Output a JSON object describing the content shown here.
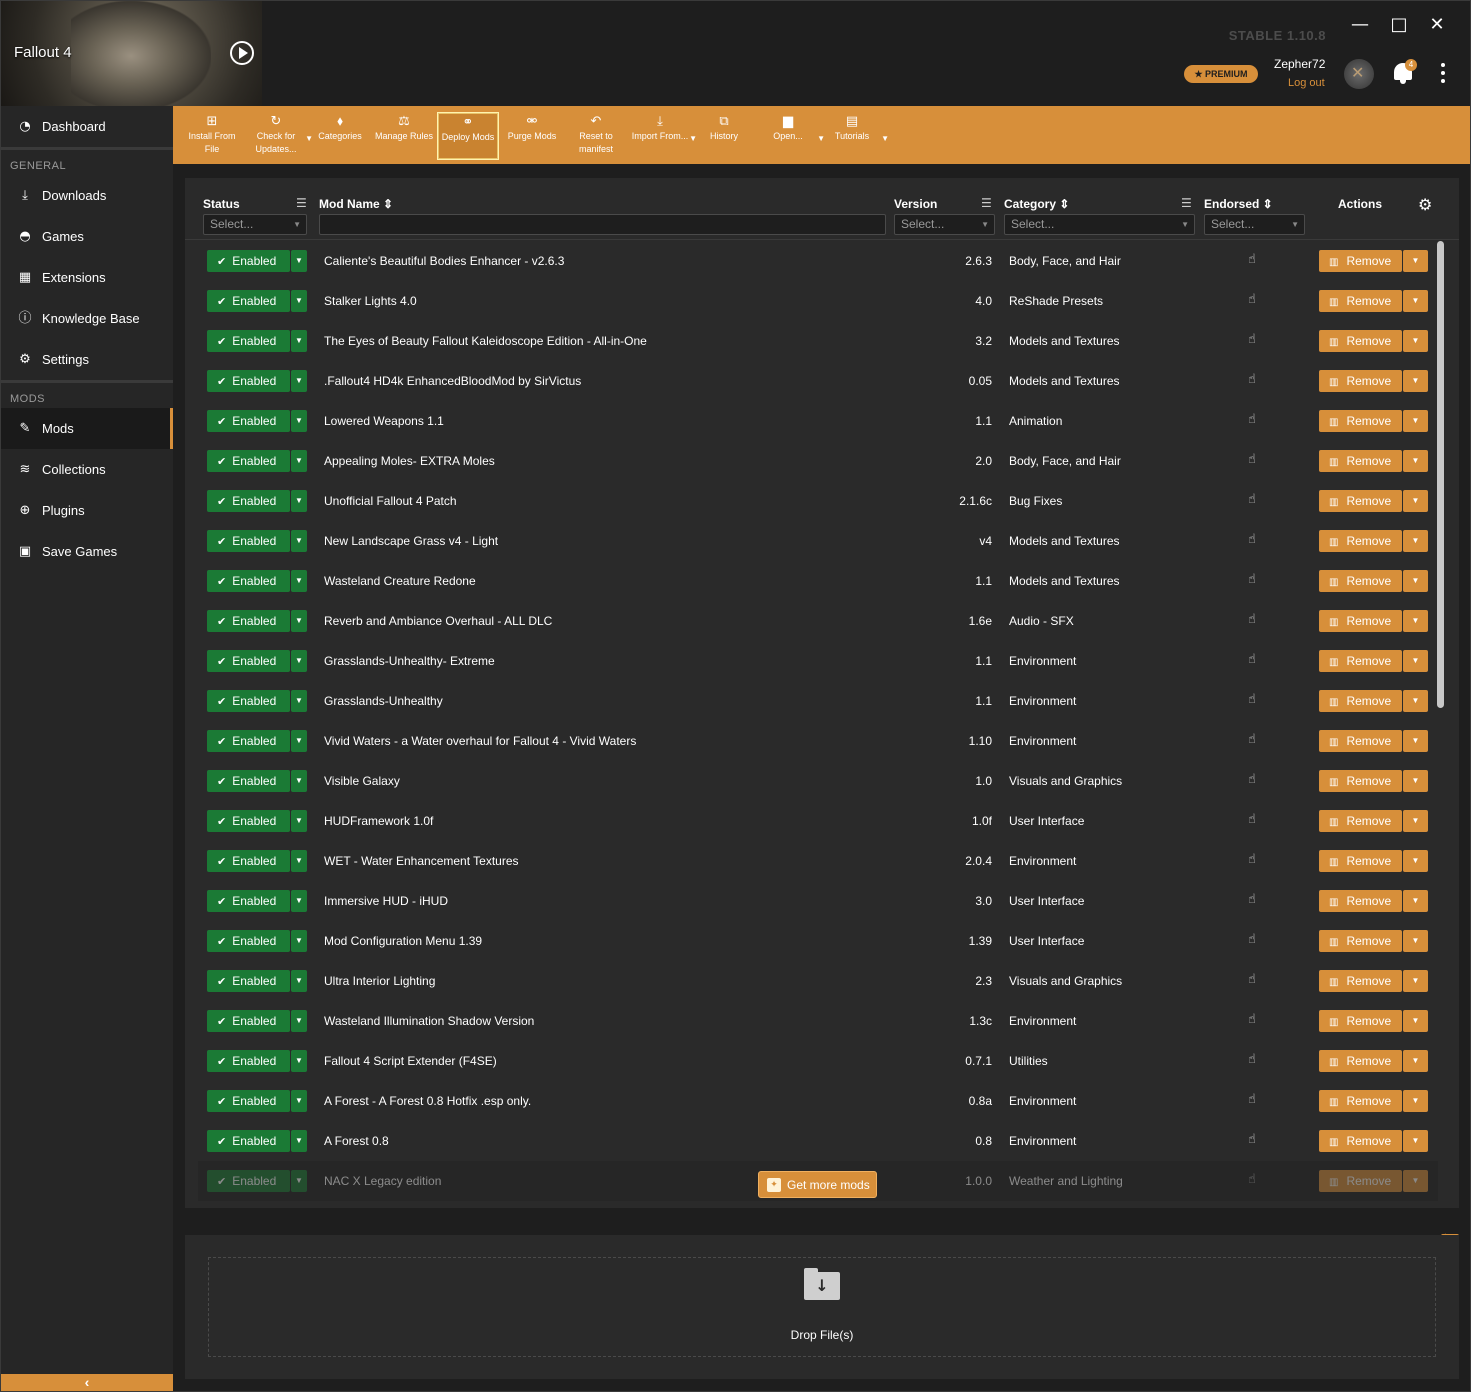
{
  "app": {
    "game_title": "Fallout 4",
    "version": "STABLE 1.10.8",
    "window_min": "—",
    "window_max": "□",
    "window_close": "✕",
    "premium_label": "★ PREMIUM",
    "username": "Zepher72",
    "logout_label": "Log out",
    "notification_count": "4",
    "colors": {
      "accent": "#d78f3a",
      "enabled": "#1b7a35",
      "background": "#1e1e1e"
    }
  },
  "sidebar": {
    "dashboard": {
      "label": "Dashboard",
      "icon": "dashboard-icon"
    },
    "general_label": "GENERAL",
    "general_items": [
      {
        "label": "Downloads",
        "icon": "download-icon"
      },
      {
        "label": "Games",
        "icon": "gamepad-icon"
      },
      {
        "label": "Extensions",
        "icon": "extensions-icon"
      },
      {
        "label": "Knowledge Base",
        "icon": "info-icon"
      },
      {
        "label": "Settings",
        "icon": "gear-icon"
      }
    ],
    "mods_label": "MODS",
    "mods_items": [
      {
        "label": "Mods",
        "icon": "wrench-icon",
        "active": true
      },
      {
        "label": "Collections",
        "icon": "layers-icon"
      },
      {
        "label": "Plugins",
        "icon": "plus-circle-icon"
      },
      {
        "label": "Save Games",
        "icon": "save-icon"
      }
    ],
    "collapse_label": "‹"
  },
  "toolbar": {
    "install": "Install From File",
    "check": "Check for Updates...",
    "categories": "Categories",
    "manage": "Manage Rules",
    "deploy": "Deploy Mods",
    "purge": "Purge Mods",
    "reset": "Reset to manifest",
    "import": "Import From...",
    "history": "History",
    "open": "Open...",
    "tutorials": "Tutorials"
  },
  "table": {
    "headers": {
      "status": "Status",
      "mod_name": "Mod Name",
      "version": "Version",
      "category": "Category",
      "endorsed": "Endorsed",
      "actions": "Actions"
    },
    "filter_placeholder": "Select...",
    "enabled_label": "Enabled",
    "remove_label": "Remove",
    "rows": [
      {
        "name": "Caliente's Beautiful Bodies Enhancer - v2.6.3",
        "version": "2.6.3",
        "category": "Body, Face, and Hair"
      },
      {
        "name": "Stalker Lights 4.0",
        "version": "4.0",
        "category": "ReShade Presets"
      },
      {
        "name": "The Eyes of Beauty Fallout Kaleidoscope Edition - All-in-One",
        "version": "3.2",
        "category": "Models and Textures"
      },
      {
        "name": ".Fallout4 HD4k EnhancedBloodMod by SirVictus",
        "version": "0.05",
        "category": "Models and Textures"
      },
      {
        "name": "Lowered Weapons 1.1",
        "version": "1.1",
        "category": "Animation"
      },
      {
        "name": "Appealing Moles- EXTRA Moles",
        "version": "2.0",
        "category": "Body, Face, and Hair"
      },
      {
        "name": "Unofficial Fallout 4 Patch",
        "version": "2.1.6c",
        "category": "Bug Fixes"
      },
      {
        "name": "New Landscape Grass v4 - Light",
        "version": "v4",
        "category": "Models and Textures"
      },
      {
        "name": "Wasteland Creature Redone",
        "version": "1.1",
        "category": "Models and Textures"
      },
      {
        "name": "Reverb and Ambiance Overhaul - ALL DLC",
        "version": "1.6e",
        "category": "Audio - SFX"
      },
      {
        "name": "Grasslands-Unhealthy- Extreme",
        "version": "1.1",
        "category": "Environment"
      },
      {
        "name": "Grasslands-Unhealthy",
        "version": "1.1",
        "category": "Environment"
      },
      {
        "name": "Vivid Waters - a Water overhaul for Fallout 4 - Vivid Waters",
        "version": "1.10",
        "category": "Environment"
      },
      {
        "name": "Visible Galaxy",
        "version": "1.0",
        "category": "Visuals and Graphics"
      },
      {
        "name": "HUDFramework 1.0f",
        "version": "1.0f",
        "category": "User Interface"
      },
      {
        "name": "WET - Water Enhancement Textures",
        "version": "2.0.4",
        "category": "Environment"
      },
      {
        "name": "Immersive HUD - iHUD",
        "version": "3.0",
        "category": "User Interface"
      },
      {
        "name": "Mod Configuration Menu 1.39",
        "version": "1.39",
        "category": "User Interface"
      },
      {
        "name": "Ultra Interior Lighting",
        "version": "2.3",
        "category": "Visuals and Graphics"
      },
      {
        "name": "Wasteland Illumination Shadow Version",
        "version": "1.3c",
        "category": "Environment"
      },
      {
        "name": "Fallout 4 Script Extender (F4SE)",
        "version": "0.7.1",
        "category": "Utilities"
      },
      {
        "name": "A Forest - A Forest 0.8 Hotfix .esp only.",
        "version": "0.8a",
        "category": "Environment"
      },
      {
        "name": "A Forest 0.8",
        "version": "0.8",
        "category": "Environment"
      },
      {
        "name": "NAC X Legacy edition",
        "version": "1.0.0",
        "category": "Weather and Lighting"
      }
    ]
  },
  "get_more_mods": "Get more mods",
  "drop_label": "Drop File(s)"
}
